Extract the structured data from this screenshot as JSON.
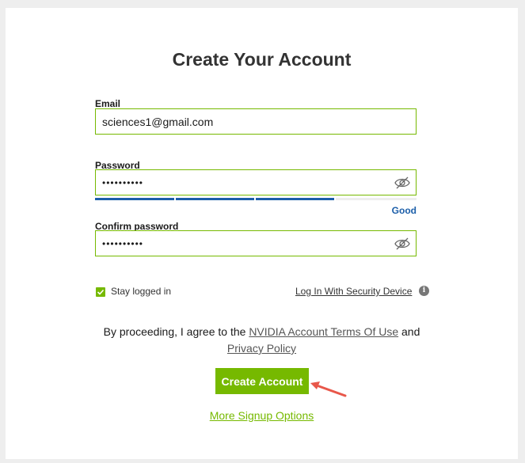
{
  "form": {
    "title": "Create Your Account",
    "email": {
      "label": "Email",
      "value": "sciences1@gmail.com"
    },
    "password": {
      "label": "Password",
      "value": "••••••••••",
      "strength_label": "Good",
      "strength_segments_filled": 3,
      "strength_segments_total": 4
    },
    "confirm_password": {
      "label": "Confirm password",
      "value": "••••••••••"
    },
    "stay_logged_in": {
      "label": "Stay logged in",
      "checked": true
    },
    "security_device_link": "Log In With Security Device",
    "terms": {
      "prefix": "By proceeding, I agree to the",
      "terms_link": "NVIDIA Account Terms Of Use",
      "and": "and",
      "privacy_link": "Privacy Policy"
    },
    "submit_label": "Create Account",
    "more_options_link": "More Signup Options"
  },
  "colors": {
    "accent": "#76b900",
    "strength": "#1b5ea9",
    "annotation_arrow": "#e8574a"
  },
  "icons": [
    "eye-slash-icon",
    "info-icon",
    "check-icon",
    "annotation-arrow"
  ]
}
